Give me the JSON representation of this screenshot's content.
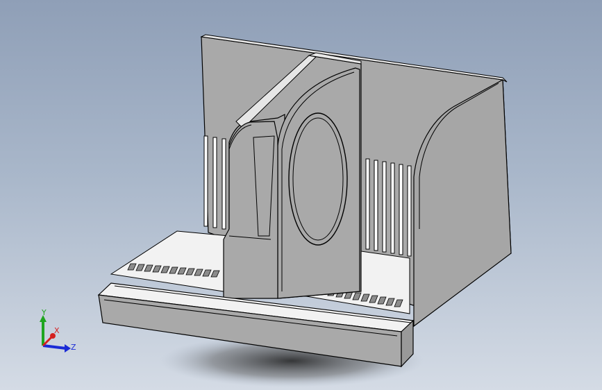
{
  "triad": {
    "x_label": "X",
    "y_label": "Y",
    "z_label": "Z",
    "x_color": "#d42020",
    "y_color": "#1fa51f",
    "z_color": "#1a2bd6"
  },
  "colors": {
    "background_top": "#8f9fb7",
    "background_bottom": "#d4dbe5",
    "part_face": "#a9a9a9",
    "part_top_face": "#f2f2f2",
    "edge": "#000000"
  }
}
